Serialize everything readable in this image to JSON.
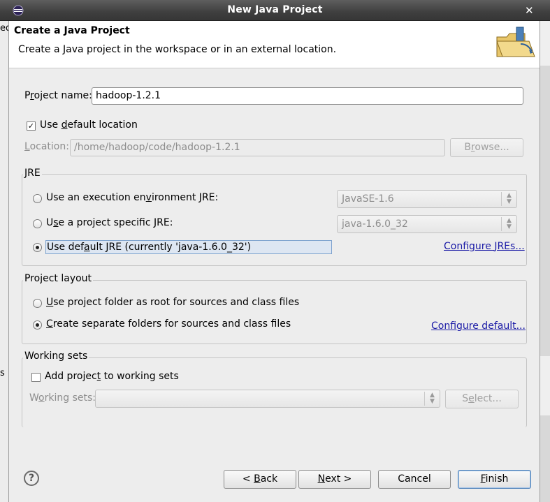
{
  "window": {
    "title": "New Java Project",
    "close_glyph": "✕"
  },
  "background": {
    "frag_top": "ed",
    "frag_mid": "s"
  },
  "header": {
    "title": "Create a Java Project",
    "description": "Create a Java project in the workspace or in an external location.",
    "icon": "java-project-folder-icon"
  },
  "project_name": {
    "label_pre": "P",
    "label_ul": "r",
    "label_post": "oject name:",
    "value": "hadoop-1.2.1"
  },
  "location": {
    "use_default_pre": "Use ",
    "use_default_ul": "d",
    "use_default_post": "efault location",
    "use_default_checked": true,
    "check_glyph": "✓",
    "label_pre": "",
    "label_ul": "L",
    "label_post": "ocation:",
    "value": "/home/hadoop/code/hadoop-1.2.1",
    "browse_pre": "B",
    "browse_ul": "r",
    "browse_post": "owse..."
  },
  "jre": {
    "group_title": "JRE",
    "option1_pre": "Use an execution en",
    "option1_ul": "v",
    "option1_post": "ironment JRE:",
    "option1_value": "JavaSE-1.6",
    "option2_pre": "U",
    "option2_ul": "s",
    "option2_post": "e a project specific JRE:",
    "option2_value": "java-1.6.0_32",
    "option3_pre": "Use def",
    "option3_ul": "a",
    "option3_post": "ult JRE (currently 'java-1.6.0_32')",
    "selected": 3,
    "configure_link_pre": "Configure ",
    "configure_link_ul": "J",
    "configure_link_post": "REs..."
  },
  "layout": {
    "group_title": "Project layout",
    "option1_pre": "",
    "option1_ul": "U",
    "option1_post": "se project folder as root for sources and class files",
    "option2_pre": "",
    "option2_ul": "C",
    "option2_post": "reate separate folders for sources and class files",
    "selected": 2,
    "configure_link_pre": "Configure d",
    "configure_link_ul": "e",
    "configure_link_post": "fault..."
  },
  "working_sets": {
    "group_title": "Working sets",
    "add_pre": "Add projec",
    "add_ul": "t",
    "add_post": " to working sets",
    "add_checked": false,
    "label_pre": "W",
    "label_ul": "o",
    "label_post": "rking sets:",
    "value": "",
    "select_pre": "S",
    "select_ul": "e",
    "select_post": "lect..."
  },
  "footer": {
    "help_glyph": "?",
    "back_pre": "< ",
    "back_ul": "B",
    "back_post": "ack",
    "next_pre": "",
    "next_ul": "N",
    "next_post": "ext >",
    "cancel": "Cancel",
    "finish_pre": "",
    "finish_ul": "F",
    "finish_post": "inish"
  }
}
